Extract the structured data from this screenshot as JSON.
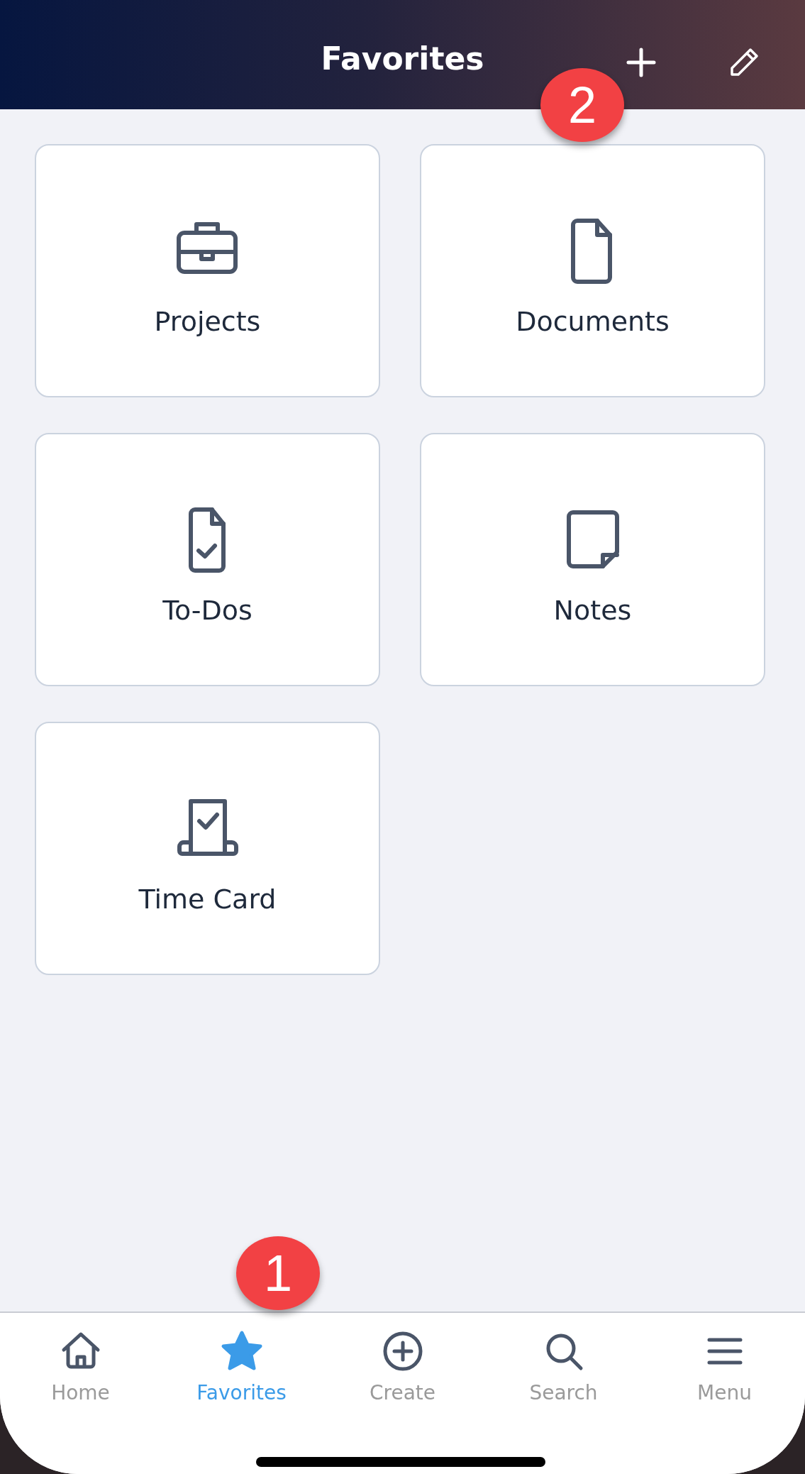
{
  "header": {
    "title": "Favorites"
  },
  "tiles": [
    {
      "label": "Projects",
      "kind": "briefcase"
    },
    {
      "label": "Documents",
      "kind": "document"
    },
    {
      "label": "To-Dos",
      "kind": "todo"
    },
    {
      "label": "Notes",
      "kind": "note"
    },
    {
      "label": "Time Card",
      "kind": "timecard"
    }
  ],
  "tab_bar": [
    {
      "label": "Home",
      "kind": "home",
      "selected": false
    },
    {
      "label": "Favorites",
      "kind": "star",
      "selected": true
    },
    {
      "label": "Create",
      "kind": "create",
      "selected": false
    },
    {
      "label": "Search",
      "kind": "search",
      "selected": false
    },
    {
      "label": "Menu",
      "kind": "menu",
      "selected": false
    }
  ],
  "callouts": [
    {
      "number": "2",
      "kind": "header"
    },
    {
      "number": "1",
      "kind": "tabbar"
    }
  ]
}
